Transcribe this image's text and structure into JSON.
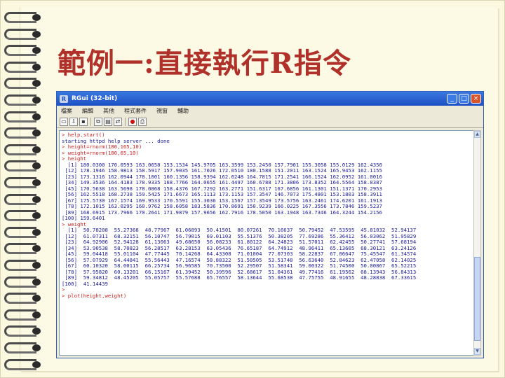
{
  "slide": {
    "title": "範例一:直接執行R指令"
  },
  "window": {
    "title": "RGui (32-bit)",
    "menus": [
      "檔案",
      "編輯",
      "其他",
      "程式套件",
      "視窗",
      "輔助"
    ],
    "toolbar_icons": [
      "open-icon",
      "load-icon",
      "save-icon",
      "copy-icon",
      "paste-icon",
      "copy-paste-icon",
      "stop-icon",
      "print-icon"
    ],
    "controls": {
      "minimize": "_",
      "maximize": "□",
      "close": "×"
    }
  },
  "console": {
    "lines": [
      {
        "type": "cmd",
        "text": "> help.start()"
      },
      {
        "type": "out",
        "text": "starting httpd help server ... done"
      },
      {
        "type": "cmd",
        "text": "> height=rnorm(100,165,10)"
      },
      {
        "type": "cmd",
        "text": "> weight=rnorm(100,65,10)"
      },
      {
        "type": "cmd",
        "text": "> height"
      },
      {
        "type": "out",
        "text": "  [1] 180.0300 170.0593 163.0658 153.1534 145.9705 163.3599 153.2450 157.7901 155.3058 155.0129 162.4350"
      },
      {
        "type": "out",
        "text": " [12] 178.1946 158.9813 158.5917 157.9035 161.7026 172.0510 180.1588 151.2011 163.1524 165.9453 162.1155"
      },
      {
        "type": "out",
        "text": " [23] 173.1316 162.0944 178.1001 160.1356 158.9394 162.0248 164.7815 171.2541 166.1524 162.0952 161.0016"
      },
      {
        "type": "out",
        "text": " [34] 149.3536 164.4183 178.9335 168.7766 164.0655 161.4497 160.6788 171.3806 173.8352 164.5564 158.8387"
      },
      {
        "type": "out",
        "text": " [45] 170.5638 163.5698 178.0868 158.4376 167.7292 163.2771 151.6317 167.6856 161.1301 151.1371 170.2953"
      },
      {
        "type": "out",
        "text": " [56] 162.5518 168.2738 159.5425 171.6673 165.1113 173.1153 157.3547 146.7073 175.4801 153.1803 158.3911"
      },
      {
        "type": "out",
        "text": " [67] 175.5730 167.1574 169.9533 170.5591 155.3036 153.1567 157.3549 173.5756 163.2461 174.6201 161.1913"
      },
      {
        "type": "out",
        "text": " [78] 172.1015 163.0295 160.9762 158.6058 183.5836 170.8691 150.9239 166.0225 167.3556 173.7846 159.5237"
      },
      {
        "type": "out",
        "text": " [89] 168.6915 173.7966 170.2641 171.9879 157.9656 162.7916 178.5050 163.1948 163.7346 164.3244 154.2156"
      },
      {
        "type": "out",
        "text": "[100] 159.6401"
      },
      {
        "type": "cmd",
        "text": "> weight"
      },
      {
        "type": "out",
        "text": "  [1]  50.78208  55.27368  48.77967  61.06893  50.41501  80.07261  70.16637  50.79452  47.53595  45.81032  52.94137"
      },
      {
        "type": "out",
        "text": " [12]  61.07311  68.32151  56.10747  56.79015  69.01103  55.51376  50.38205  77.69286  55.36412  56.03062  51.95829"
      },
      {
        "type": "out",
        "text": " [23]  64.92906  52.94128  61.13063  49.68650  56.08233  61.80122  64.24823  51.57011  62.42455  50.27741  57.68194"
      },
      {
        "type": "out",
        "text": " [34]  53.90538  58.70823  56.28517  63.28153  63.05436  76.65187  64.74912  48.96411  65.13605  68.30121  63.24126"
      },
      {
        "type": "out",
        "text": " [45]  59.04418  55.01104  47.77445  70.14268  64.43308  71.01004  77.07303  58.22837  67.06647  75.45547  61.34574"
      },
      {
        "type": "out",
        "text": " [56]  57.07929  64.44841  55.56443  47.16574  58.88322  51.50505  53.51748  56.63640  52.84623  62.47058  62.14025"
      },
      {
        "type": "out",
        "text": " [67]  60.10320  58.00115  66.25734  56.96585  70.73500  52.29507  51.58341  59.00322  51.74500  50.00867  65.52215"
      },
      {
        "type": "out",
        "text": " [78]  57.95820  60.13201  66.15167  61.39452  50.39596  52.68617  51.04361  49.77416  61.19562  68.13943  56.84313"
      },
      {
        "type": "out",
        "text": " [89]  59.34812  48.45205  55.05757  55.57688  65.76557  58.13644  55.68538  47.75755  48.91655  48.28838  67.33615"
      },
      {
        "type": "out",
        "text": "[100]  41.14439"
      },
      {
        "type": "cmd",
        "text": "> "
      },
      {
        "type": "cmd",
        "text": "> plot(height,weight)"
      }
    ]
  },
  "colors": {
    "slide_bg": "#fbf8e0",
    "title_red": "#b0302a",
    "console_cmd": "#d11b1b",
    "console_out": "#1a1a9a",
    "titlebar_blue": "#1d4fc4"
  }
}
